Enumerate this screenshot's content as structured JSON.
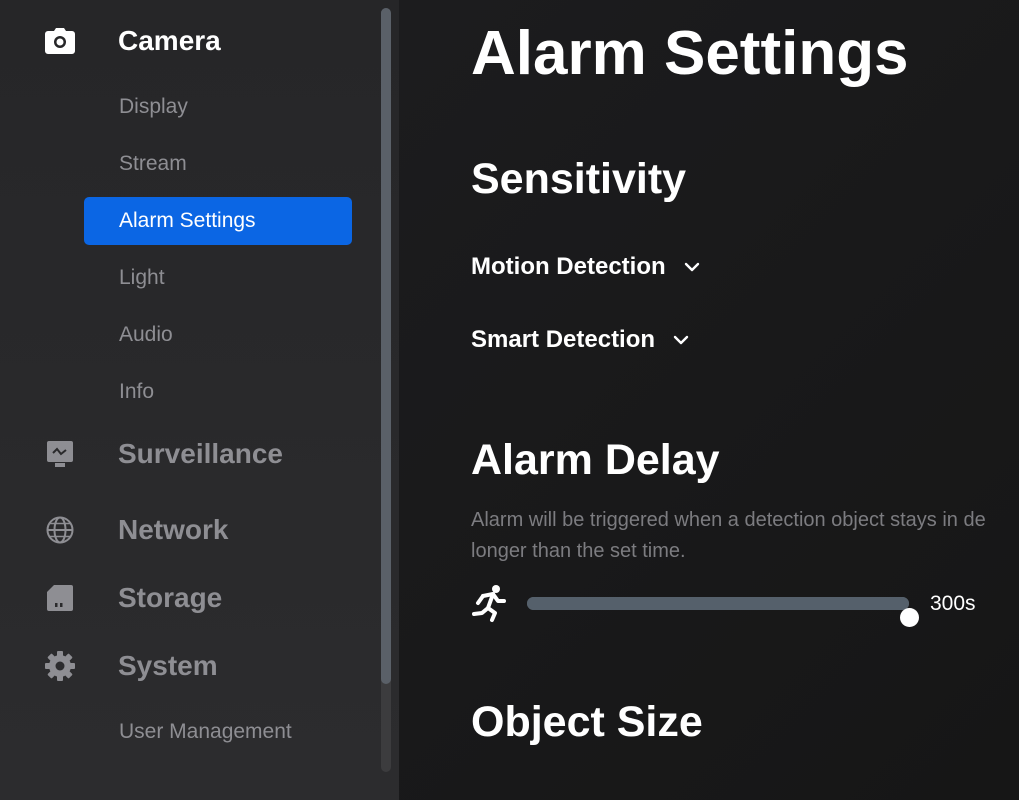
{
  "sidebar": {
    "camera": {
      "label": "Camera",
      "icon": "camera-icon",
      "items": [
        {
          "label": "Display"
        },
        {
          "label": "Stream"
        },
        {
          "label": "Alarm Settings",
          "selected": true
        },
        {
          "label": "Light"
        },
        {
          "label": "Audio"
        },
        {
          "label": "Info"
        }
      ]
    },
    "surveillance": {
      "label": "Surveillance",
      "icon": "monitor-icon"
    },
    "network": {
      "label": "Network",
      "icon": "globe-icon"
    },
    "storage": {
      "label": "Storage",
      "icon": "sd-card-icon"
    },
    "system": {
      "label": "System",
      "icon": "gear-icon",
      "items": [
        {
          "label": "User Management"
        }
      ]
    }
  },
  "main": {
    "title": "Alarm Settings",
    "sensitivity": {
      "heading": "Sensitivity",
      "motion_detection": "Motion Detection",
      "smart_detection": "Smart Detection"
    },
    "alarm_delay": {
      "heading": "Alarm Delay",
      "description_line1": "Alarm will be triggered when a detection object stays in de",
      "description_line2": "longer than the set time.",
      "icon": "running-person-icon",
      "value_label": "300s",
      "slider_fraction": 1.0
    },
    "object_size": {
      "heading": "Object Size"
    }
  },
  "colors": {
    "accent": "#0b66e4",
    "sidebar_bg": "#2a2a2c",
    "main_bg": "#1a1a1a",
    "muted_text": "#8e8e93",
    "slider_track": "#55606b"
  }
}
